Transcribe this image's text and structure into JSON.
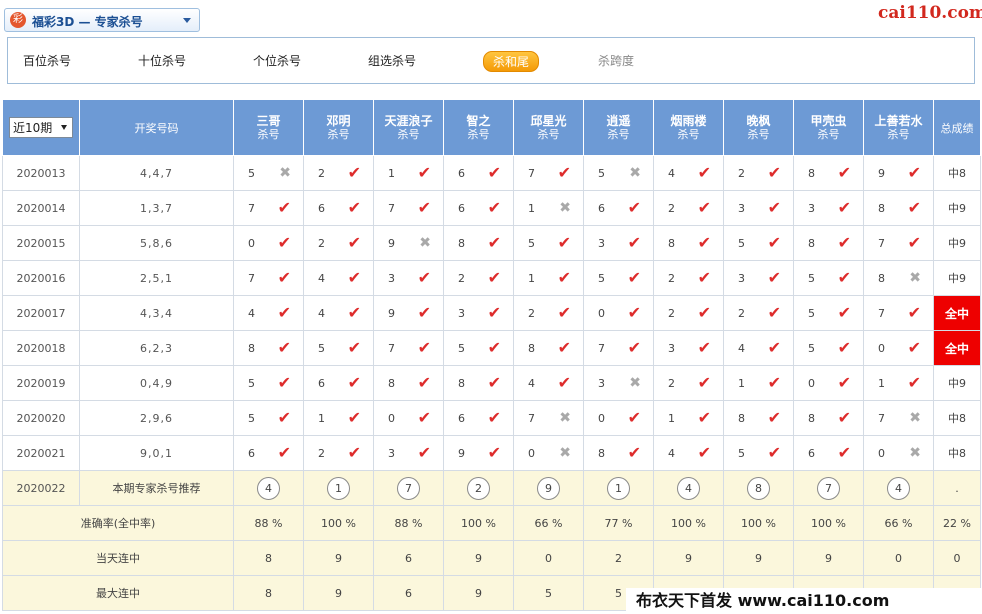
{
  "header": {
    "lottery_icon": "彩",
    "selector_text": "福彩3D — 专家杀号",
    "logo": "cai110.com"
  },
  "tabs": [
    {
      "label": "百位杀号",
      "state": "normal"
    },
    {
      "label": "十位杀号",
      "state": "normal"
    },
    {
      "label": "个位杀号",
      "state": "normal"
    },
    {
      "label": "组选杀号",
      "state": "normal"
    },
    {
      "label": "杀和尾",
      "state": "active"
    },
    {
      "label": "杀跨度",
      "state": "muted"
    }
  ],
  "table": {
    "period_select": "近10期",
    "draw_header": "开奖号码",
    "sub_label": "杀号",
    "total_header": "总成绩",
    "experts": [
      "三哥",
      "邓明",
      "天涯浪子",
      "智之",
      "邱星光",
      "逍遥",
      "烟雨楼",
      "晚枫",
      "甲壳虫",
      "上善若水"
    ],
    "rows": [
      {
        "issue": "2020013",
        "draw": "4,4,7",
        "kills": [
          [
            "5",
            "miss"
          ],
          [
            "2",
            "hit"
          ],
          [
            "1",
            "hit"
          ],
          [
            "6",
            "hit"
          ],
          [
            "7",
            "hit"
          ],
          [
            "5",
            "miss"
          ],
          [
            "4",
            "hit"
          ],
          [
            "2",
            "hit"
          ],
          [
            "8",
            "hit"
          ],
          [
            "9",
            "hit"
          ]
        ],
        "total": "中8",
        "all_hit": false
      },
      {
        "issue": "2020014",
        "draw": "1,3,7",
        "kills": [
          [
            "7",
            "hit"
          ],
          [
            "6",
            "hit"
          ],
          [
            "7",
            "hit"
          ],
          [
            "6",
            "hit"
          ],
          [
            "1",
            "miss"
          ],
          [
            "6",
            "hit"
          ],
          [
            "2",
            "hit"
          ],
          [
            "3",
            "hit"
          ],
          [
            "3",
            "hit"
          ],
          [
            "8",
            "hit"
          ]
        ],
        "total": "中9",
        "all_hit": false
      },
      {
        "issue": "2020015",
        "draw": "5,8,6",
        "kills": [
          [
            "0",
            "hit"
          ],
          [
            "2",
            "hit"
          ],
          [
            "9",
            "miss"
          ],
          [
            "8",
            "hit"
          ],
          [
            "5",
            "hit"
          ],
          [
            "3",
            "hit"
          ],
          [
            "8",
            "hit"
          ],
          [
            "5",
            "hit"
          ],
          [
            "8",
            "hit"
          ],
          [
            "7",
            "hit"
          ]
        ],
        "total": "中9",
        "all_hit": false
      },
      {
        "issue": "2020016",
        "draw": "2,5,1",
        "kills": [
          [
            "7",
            "hit"
          ],
          [
            "4",
            "hit"
          ],
          [
            "3",
            "hit"
          ],
          [
            "2",
            "hit"
          ],
          [
            "1",
            "hit"
          ],
          [
            "5",
            "hit"
          ],
          [
            "2",
            "hit"
          ],
          [
            "3",
            "hit"
          ],
          [
            "5",
            "hit"
          ],
          [
            "8",
            "miss"
          ]
        ],
        "total": "中9",
        "all_hit": false
      },
      {
        "issue": "2020017",
        "draw": "4,3,4",
        "kills": [
          [
            "4",
            "hit"
          ],
          [
            "4",
            "hit"
          ],
          [
            "9",
            "hit"
          ],
          [
            "3",
            "hit"
          ],
          [
            "2",
            "hit"
          ],
          [
            "0",
            "hit"
          ],
          [
            "2",
            "hit"
          ],
          [
            "2",
            "hit"
          ],
          [
            "5",
            "hit"
          ],
          [
            "7",
            "hit"
          ]
        ],
        "total": "全中",
        "all_hit": true
      },
      {
        "issue": "2020018",
        "draw": "6,2,3",
        "kills": [
          [
            "8",
            "hit"
          ],
          [
            "5",
            "hit"
          ],
          [
            "7",
            "hit"
          ],
          [
            "5",
            "hit"
          ],
          [
            "8",
            "hit"
          ],
          [
            "7",
            "hit"
          ],
          [
            "3",
            "hit"
          ],
          [
            "4",
            "hit"
          ],
          [
            "5",
            "hit"
          ],
          [
            "0",
            "hit"
          ]
        ],
        "total": "全中",
        "all_hit": true
      },
      {
        "issue": "2020019",
        "draw": "0,4,9",
        "kills": [
          [
            "5",
            "hit"
          ],
          [
            "6",
            "hit"
          ],
          [
            "8",
            "hit"
          ],
          [
            "8",
            "hit"
          ],
          [
            "4",
            "hit"
          ],
          [
            "3",
            "miss"
          ],
          [
            "2",
            "hit"
          ],
          [
            "1",
            "hit"
          ],
          [
            "0",
            "hit"
          ],
          [
            "1",
            "hit"
          ]
        ],
        "total": "中9",
        "all_hit": false
      },
      {
        "issue": "2020020",
        "draw": "2,9,6",
        "kills": [
          [
            "5",
            "hit"
          ],
          [
            "1",
            "hit"
          ],
          [
            "0",
            "hit"
          ],
          [
            "6",
            "hit"
          ],
          [
            "7",
            "miss"
          ],
          [
            "0",
            "hit"
          ],
          [
            "1",
            "hit"
          ],
          [
            "8",
            "hit"
          ],
          [
            "8",
            "hit"
          ],
          [
            "7",
            "miss"
          ]
        ],
        "total": "中8",
        "all_hit": false
      },
      {
        "issue": "2020021",
        "draw": "9,0,1",
        "kills": [
          [
            "6",
            "hit"
          ],
          [
            "2",
            "hit"
          ],
          [
            "3",
            "hit"
          ],
          [
            "9",
            "hit"
          ],
          [
            "0",
            "miss"
          ],
          [
            "8",
            "hit"
          ],
          [
            "4",
            "hit"
          ],
          [
            "5",
            "hit"
          ],
          [
            "6",
            "hit"
          ],
          [
            "0",
            "miss"
          ]
        ],
        "total": "中8",
        "all_hit": false
      }
    ],
    "recommendation": {
      "issue": "2020022",
      "label": "本期专家杀号推荐",
      "values": [
        "4",
        "1",
        "7",
        "2",
        "9",
        "1",
        "4",
        "8",
        "7",
        "4"
      ],
      "total": "."
    },
    "stats": [
      {
        "label": "准确率(全中率)",
        "values": [
          "88 %",
          "100 %",
          "88 %",
          "100 %",
          "66 %",
          "77 %",
          "100 %",
          "100 %",
          "100 %",
          "66 %"
        ],
        "total": "22 %"
      },
      {
        "label": "当天连中",
        "values": [
          "8",
          "9",
          "6",
          "9",
          "0",
          "2",
          "9",
          "9",
          "9",
          "0"
        ],
        "total": "0"
      },
      {
        "label": "最大连中",
        "values": [
          "8",
          "9",
          "6",
          "9",
          "5",
          "5",
          "",
          "",
          "",
          ""
        ],
        "total": ""
      }
    ]
  },
  "watermark": "布衣天下首发 www.cai110.com",
  "colors": {
    "header_blue": "#6d9ad5",
    "hit_red": "#de2c2c",
    "miss_gray": "#a9a9a9",
    "all_hit_bg": "#ee0000",
    "active_tab_orange": "#f49a07",
    "stat_row_bg": "#fbf7dc",
    "logo_red": "#d2281e"
  },
  "icons": {
    "hit": "check-mark-icon",
    "miss": "cross-mark-icon",
    "dropdown": "chevron-down-icon"
  }
}
